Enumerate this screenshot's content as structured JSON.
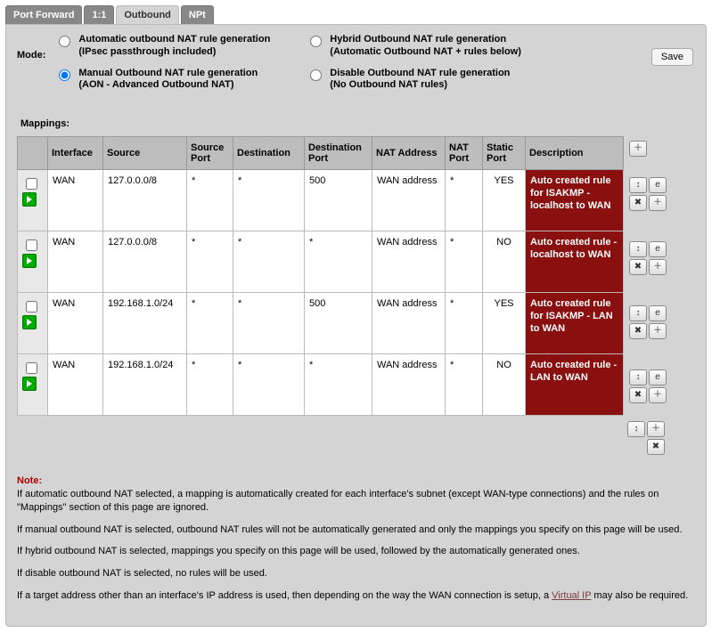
{
  "tabs": {
    "port_forward": "Port Forward",
    "one_one": "1:1",
    "outbound": "Outbound",
    "npt": "NPt"
  },
  "mode": {
    "label": "Mode:",
    "opt1_l1": "Automatic outbound NAT rule generation",
    "opt1_l2": "(IPsec passthrough included)",
    "opt2_l1": "Manual Outbound NAT rule generation",
    "opt2_l2": "(AON - Advanced Outbound NAT)",
    "opt3_l1": "Hybrid Outbound NAT rule generation",
    "opt3_l2": "(Automatic Outbound NAT + rules below)",
    "opt4_l1": "Disable Outbound NAT rule generation",
    "opt4_l2": "(No Outbound NAT rules)"
  },
  "save_label": "Save",
  "mappings_title": "Mappings:",
  "headers": {
    "interface": "Interface",
    "source": "Source",
    "source_port": "Source Port",
    "destination": "Destination",
    "dest_port": "Destination Port",
    "nat_addr": "NAT Address",
    "nat_port": "NAT Port",
    "static_port": "Static Port",
    "description": "Description"
  },
  "rows": [
    {
      "interface": "WAN",
      "source": "127.0.0.0/8",
      "source_port": "*",
      "destination": "*",
      "dest_port": "500",
      "nat_addr": "WAN address",
      "nat_port": "*",
      "static_port": "YES",
      "description": "Auto created rule for ISAKMP - localhost to WAN"
    },
    {
      "interface": "WAN",
      "source": "127.0.0.0/8",
      "source_port": "*",
      "destination": "*",
      "dest_port": "*",
      "nat_addr": "WAN address",
      "nat_port": "*",
      "static_port": "NO",
      "description": "Auto created rule - localhost to WAN"
    },
    {
      "interface": "WAN",
      "source": "192.168.1.0/24",
      "source_port": "*",
      "destination": "*",
      "dest_port": "500",
      "nat_addr": "WAN address",
      "nat_port": "*",
      "static_port": "YES",
      "description": "Auto created rule for ISAKMP - LAN to WAN"
    },
    {
      "interface": "WAN",
      "source": "192.168.1.0/24",
      "source_port": "*",
      "destination": "*",
      "dest_port": "*",
      "nat_addr": "WAN address",
      "nat_port": "*",
      "static_port": "NO",
      "description": "Auto created rule - LAN to WAN"
    }
  ],
  "note": {
    "hdr": "Note:",
    "p1": "If automatic outbound NAT selected, a mapping is automatically created for each interface's subnet (except WAN-type connections) and the rules on \"Mappings\" section of this page are ignored.",
    "p2": "If manual outbound NAT is selected, outbound NAT rules will not be automatically generated and only the mappings you specify on this page will be used.",
    "p3": "If hybrid outbound NAT is selected, mappings you specify on this page will be used, followed by the automatically generated ones.",
    "p4": "If disable outbound NAT is selected, no rules will be used.",
    "p5a": "If a target address other than an interface's IP address is used, then depending on the way the WAN connection is setup, a ",
    "p5_link": "Virtual IP",
    "p5b": " may also be required."
  }
}
